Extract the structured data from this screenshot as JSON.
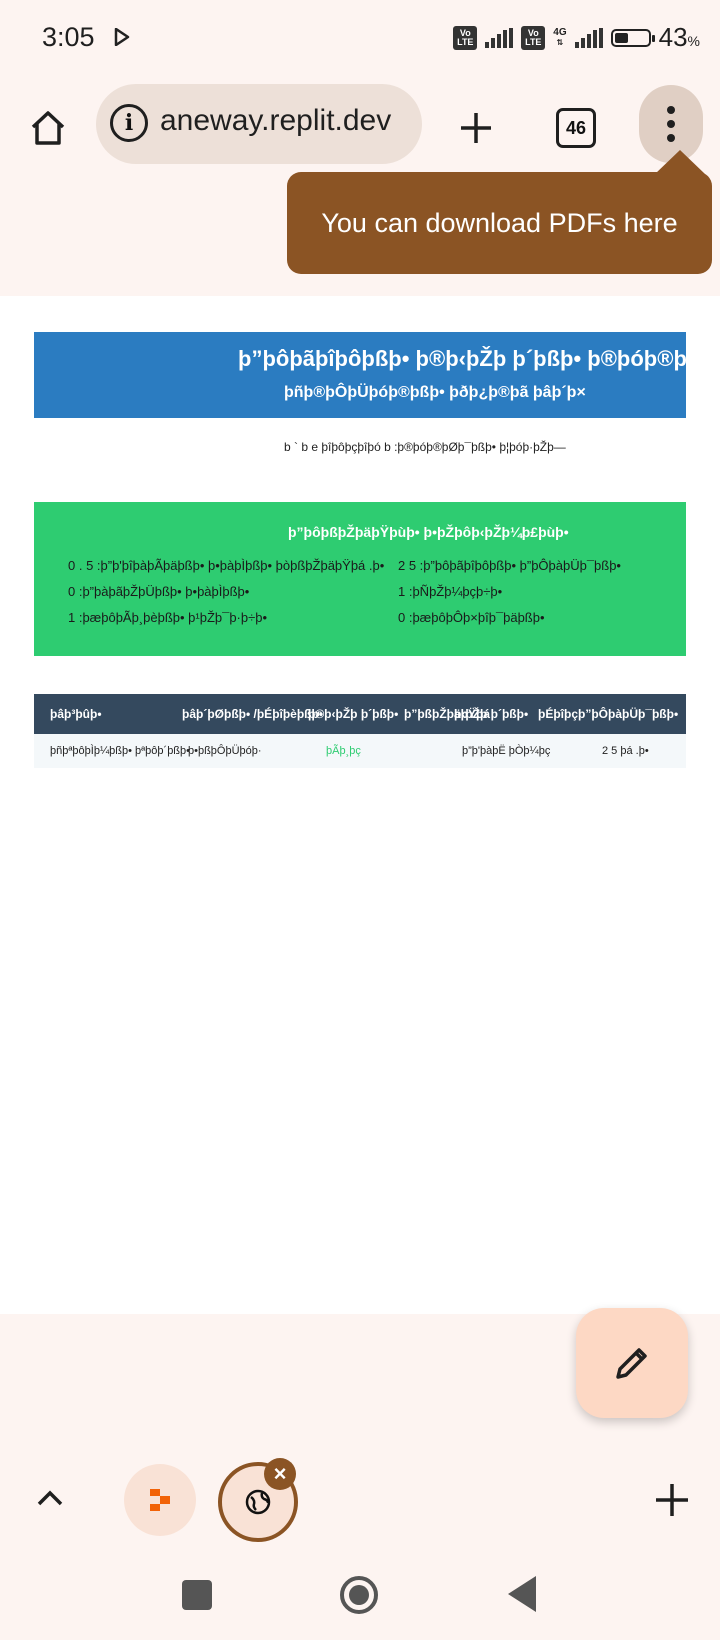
{
  "status_bar": {
    "time": "3:05",
    "network": "4G",
    "battery_percent": "43",
    "battery_unit": "%",
    "volte_label": "Vo LTE",
    "battery_level": 0.43
  },
  "browser": {
    "url": "aneway.replit.dev",
    "tab_count": "46",
    "tooltip": "You can download PDFs here"
  },
  "page": {
    "header_title": "þ”þôþãþîþôþßþ•  þ®þ‹þŽþ þ´þßþ•  þ®þóþ®þ",
    "header_subtitle": "þñþ®þÔþÜþóþ®þßþ•  þðþ¿þ®þã  þâþ´þ×",
    "meta_line": "b ` b e  þîþôþçþîþó   b   :þ®þóþ®þØþ¯þßþ•  þ¦þóþ·þŽþ—",
    "summary": {
      "title": "þ”þôþßþŽþäþŸþùþ•  þ•þŽþôþ‹þŽþ¼þ£þùþ•",
      "items": [
        "0 . 5   :þ”þ'þîþàþÃþäþßþ•  þ•þàþÌþßþ•  þòþßþŽþäþŸþá .þ•",
        "2 5   :þ”þôþãþîþôþßþ•  þ”þÔþàþÜþ¯þßþ•",
        "0   :þ”þàþãþŽþÜþßþ•  þ•þàþÌþßþ•",
        "1   :þÑþŽþ¼þçþ÷þ•",
        "1   :þæþôþÃþ¸þèþßþ•  þ¹þŽþ¯þ·þ÷þ•",
        "0   :þæþôþÔþ×þîþ¯þäþßþ•"
      ]
    },
    "table": {
      "headers": [
        "þâþ³þûþ•",
        "þâþ´þØþßþ• /þÉþîþèþßþ•",
        "þ®þ‹þŽþ þ´þßþ•",
        "þ”þßþŽþäþŸþá",
        "þ‹þŽþ þ´þßþ•",
        "þÉþîþçþ”þÔþàþÜþ¯þßþ•"
      ],
      "row": [
        "þñþªþôþÌþ¼þßþ•  þªþôþ´þßþ•",
        "þ•þßþÔþÜþóþ·",
        "þÃþ¸þç",
        "þ”þ'þàþË  þÒþ¼þç",
        "2 5  þá .þ•"
      ]
    }
  },
  "colors": {
    "accent_brown": "#8b5424",
    "header_blue": "#2b7cc1",
    "summary_green": "#2ecc71",
    "table_header": "#34495e",
    "chrome_bg": "#fdf4f1"
  }
}
